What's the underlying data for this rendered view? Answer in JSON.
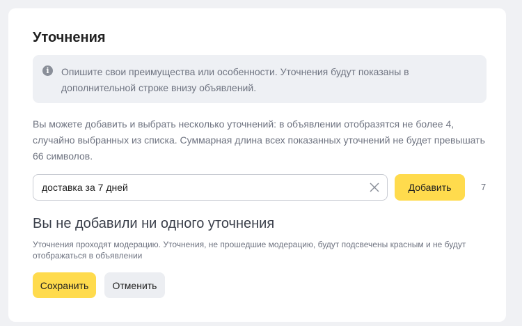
{
  "section": {
    "title": "Уточнения"
  },
  "info": {
    "icon": "info-icon",
    "text": "Опишите свои преимущества или особенности. Уточнения будут показаны в дополнительной строке внизу объявлений."
  },
  "description": "Вы можете добавить и выбрать несколько уточнений: в объявлении отобразятся не более 4, случайно выбранных из списка. Суммарная длина всех показанных уточнений не будет превышать 66 символов.",
  "input": {
    "value": "доставка за 7 дней",
    "placeholder": ""
  },
  "add_button": {
    "label": "Добавить"
  },
  "counter": "7",
  "empty_state": {
    "title": "Вы не добавили ни одного уточнения",
    "note": "Уточнения проходят модерацию. Уточнения, не прошедшие модерацию, будут подсвечены красным и не будут отображаться в объявлении"
  },
  "actions": {
    "save_label": "Сохранить",
    "cancel_label": "Отменить"
  },
  "colors": {
    "accent": "#ffdb4d",
    "secondary_button": "#eceef2",
    "info_background": "#eef0f4"
  }
}
